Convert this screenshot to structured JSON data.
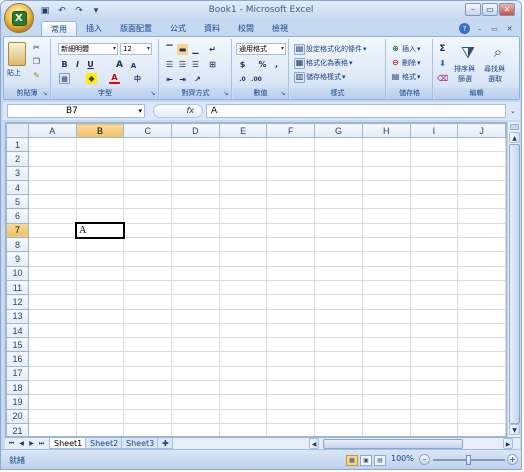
{
  "window": {
    "title": "Book1 - Microsoft Excel",
    "orb_logo": "X",
    "buttons": [
      "–",
      "▭",
      "✕"
    ]
  },
  "quick_access": [
    {
      "icon": "save-icon",
      "glyph": "▣"
    },
    {
      "icon": "undo-icon",
      "glyph": "↶"
    },
    {
      "icon": "redo-icon",
      "glyph": "↷"
    },
    {
      "icon": "customize-icon",
      "glyph": "▾"
    }
  ],
  "tabs": [
    "常用",
    "插入",
    "版面配置",
    "公式",
    "資料",
    "校閱",
    "檢視"
  ],
  "active_tab": "常用",
  "ribbon": {
    "clipboard": {
      "paste": "貼上",
      "label": "剪貼簿"
    },
    "font": {
      "name": "新細明體",
      "size": "12",
      "bold": "B",
      "italic": "I",
      "underline": "U",
      "grow": "A",
      "shrink": "A",
      "font_color": "A",
      "label": "字型"
    },
    "alignment": {
      "label": "對齊方式"
    },
    "number": {
      "format": "通用格式",
      "currency": "$",
      "percent": "%",
      "comma": ",",
      "label": "數值"
    },
    "styles": {
      "conditional": "設定格式化的條件",
      "table": "格式化為表格",
      "cell_styles": "儲存格樣式",
      "label": "樣式"
    },
    "cells": {
      "insert": "插入",
      "delete": "刪除",
      "format": "格式",
      "label": "儲存格"
    },
    "editing": {
      "sum": "Σ",
      "sort1": "排序與",
      "sort2": "篩選",
      "find1": "尋找與",
      "find2": "選取",
      "label": "編輯"
    }
  },
  "formula_bar": {
    "name_box": "B7",
    "fx": "fx",
    "content": "A"
  },
  "grid": {
    "columns": [
      "A",
      "B",
      "C",
      "D",
      "E",
      "F",
      "G",
      "H",
      "I",
      "J"
    ],
    "rows": [
      "1",
      "2",
      "3",
      "4",
      "5",
      "6",
      "7",
      "8",
      "9",
      "10",
      "11",
      "12",
      "13",
      "14",
      "15",
      "16",
      "17",
      "18",
      "19",
      "20",
      "21"
    ],
    "selected_column": "B",
    "selected_row": "7",
    "active_cell_value": "A"
  },
  "sheets": [
    "Sheet1",
    "Sheet2",
    "Sheet3"
  ],
  "active_sheet": "Sheet1",
  "status_bar": {
    "mode": "就緒",
    "zoom": "100%"
  }
}
